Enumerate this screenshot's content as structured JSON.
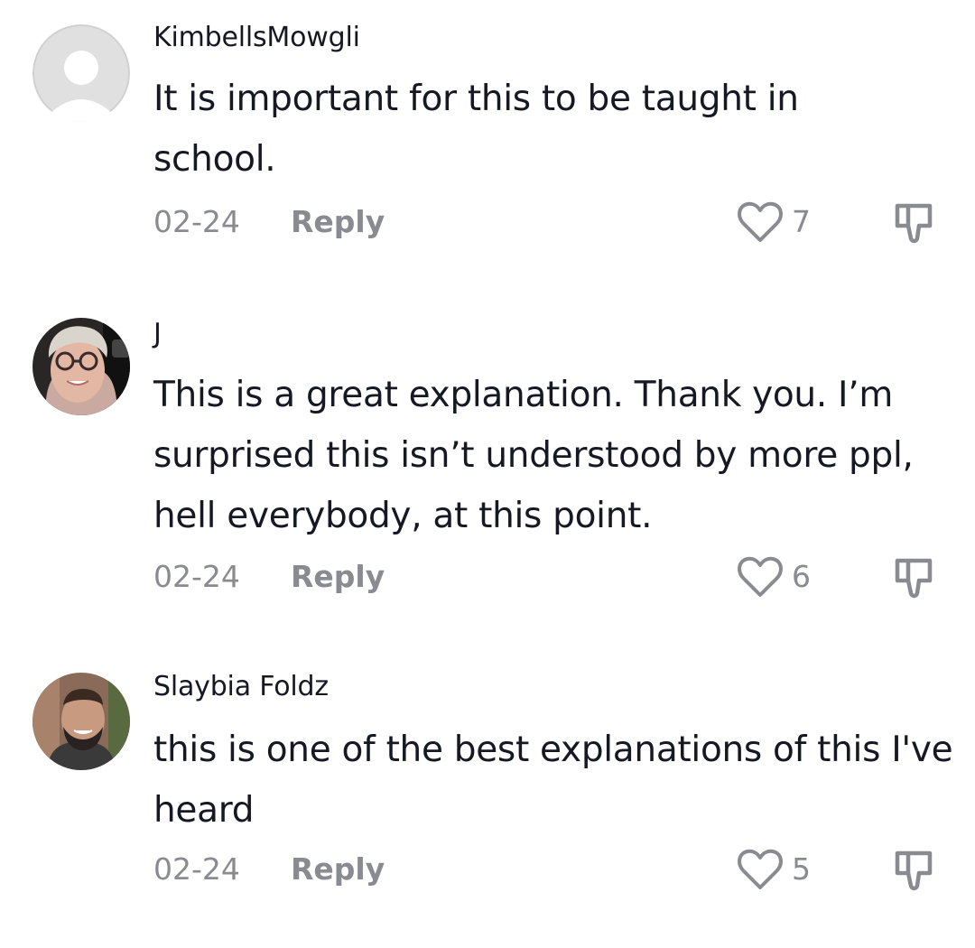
{
  "comments": [
    {
      "username": "KimbellsMowgli",
      "text": "It is important for this to be taught in school.",
      "date": "02-24",
      "reply_label": "Reply",
      "likes": "7",
      "avatar": "default-avatar-icon"
    },
    {
      "username": "J",
      "text": "This is a great explanation. Thank you. I’m surprised this isn’t understood by more ppl, hell everybody, at this point.",
      "date": "02-24",
      "reply_label": "Reply",
      "likes": "6",
      "avatar": "user-photo"
    },
    {
      "username": "Slaybia Foldz",
      "text": "this is one of the best explanations of this I've heard",
      "date": "02-24",
      "reply_label": "Reply",
      "likes": "5",
      "avatar": "user-photo"
    }
  ],
  "colors": {
    "primary_text": "#161823",
    "secondary_text": "#8a8b91",
    "icon_stroke": "#8a8b91"
  }
}
